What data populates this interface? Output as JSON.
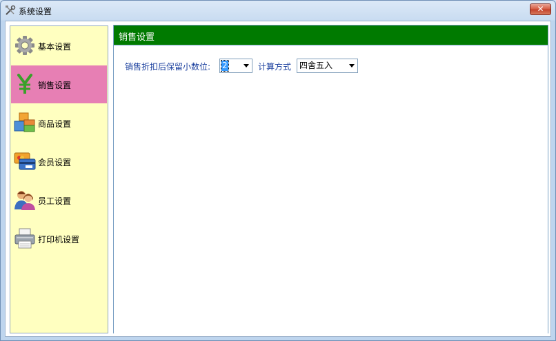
{
  "window": {
    "title": "系统设置",
    "close_label": "✕"
  },
  "sidebar": {
    "items": [
      {
        "label": "基本设置",
        "icon": "gear-icon"
      },
      {
        "label": "销售设置",
        "icon": "yen-icon",
        "active": true
      },
      {
        "label": "商品设置",
        "icon": "boxes-icon"
      },
      {
        "label": "会员设置",
        "icon": "member-card-icon"
      },
      {
        "label": "员工设置",
        "icon": "staff-icon"
      },
      {
        "label": "打印机设置",
        "icon": "printer-icon"
      }
    ]
  },
  "panel": {
    "title": "销售设置",
    "decimal_label": "销售折扣后保留小数位:",
    "decimal_value": "2",
    "rounding_label": "计算方式",
    "rounding_value": "四舍五入"
  },
  "colors": {
    "active_item": "#e77fb4",
    "header_bg": "#007a00",
    "sidebar_bg": "#ffffc0"
  }
}
